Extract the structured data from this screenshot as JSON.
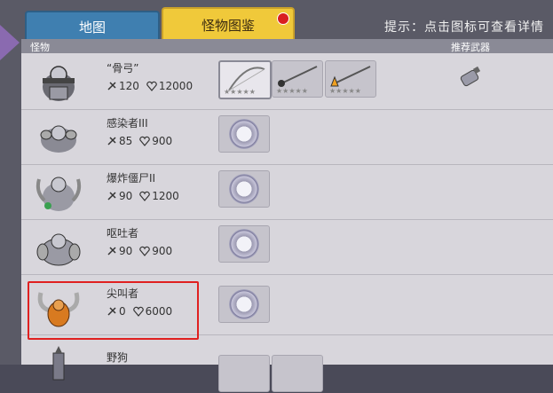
{
  "tabs": {
    "map": "地图",
    "bestiary": "怪物图鉴"
  },
  "hint": "提示：点击图标可查看详情",
  "table": {
    "col_monster": "怪物",
    "col_weapon": "推荐武器"
  },
  "monsters": [
    {
      "name": "“骨弓”",
      "attack": "120",
      "hp": "12000",
      "weapons": [
        "bow",
        "spear",
        "flame-spear"
      ],
      "stars": "★★★★★"
    },
    {
      "name": "感染者III",
      "attack": "85",
      "hp": "900"
    },
    {
      "name": "爆炸僵尸II",
      "attack": "90",
      "hp": "1200"
    },
    {
      "name": "呕吐者",
      "attack": "90",
      "hp": "900"
    },
    {
      "name": "尖叫者",
      "attack": "0",
      "hp": "6000"
    },
    {
      "name": "野狗"
    }
  ],
  "colors": {
    "highlight": "#e02020",
    "tab_active": "#f0c93a",
    "tab_inactive": "#3f7fb0"
  }
}
